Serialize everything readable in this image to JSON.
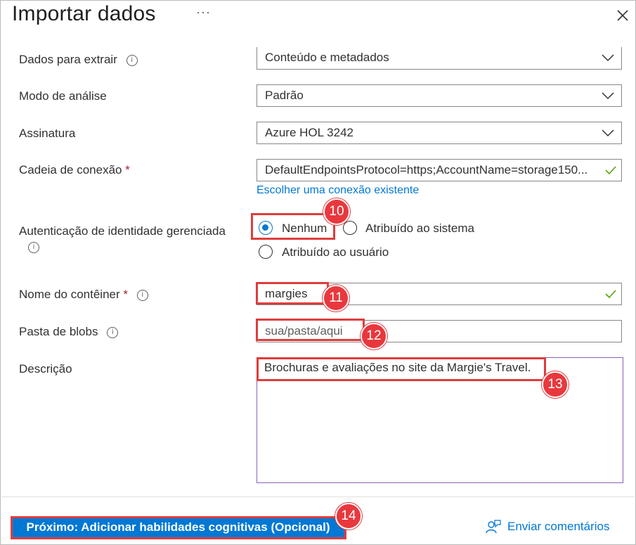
{
  "header": {
    "title": "Importar dados",
    "more_label": "···"
  },
  "form": {
    "data_to_extract": {
      "label": "Dados para extrair",
      "value": "Conteúdo e metadados"
    },
    "parsing_mode": {
      "label": "Modo de análise",
      "value": "Padrão"
    },
    "subscription": {
      "label": "Assinatura",
      "value": "Azure HOL 3242"
    },
    "connection_string": {
      "label": "Cadeia de conexão",
      "required": "*",
      "value": "DefaultEndpointsProtocol=https;AccountName=storage150...",
      "link": "Escolher uma conexão existente"
    },
    "managed_identity": {
      "label": "Autenticação de identidade gerenciada",
      "options": [
        "Nenhum",
        "Atribuído ao sistema",
        "Atribuído ao usuário"
      ],
      "selected": "Nenhum"
    },
    "container_name": {
      "label": "Nome do contêiner",
      "required": "*",
      "value": "margies"
    },
    "blob_folder": {
      "label": "Pasta de blobs",
      "placeholder": "sua/pasta/aqui"
    },
    "description": {
      "label": "Descrição",
      "value": "Brochuras e avaliações no site da Margie's Travel."
    }
  },
  "callouts": [
    "10",
    "11",
    "12",
    "13",
    "14"
  ],
  "footer": {
    "next_button": "Próximo: Adicionar habilidades cognitivas (Opcional)",
    "feedback": "Enviar comentários"
  },
  "colors": {
    "accent": "#0078d4",
    "callout": "#e8383d",
    "success": "#57a300"
  },
  "icons": [
    "more-icon",
    "close-icon",
    "info-icon",
    "chevron-down-icon",
    "checkmark-icon",
    "feedback-icon"
  ]
}
